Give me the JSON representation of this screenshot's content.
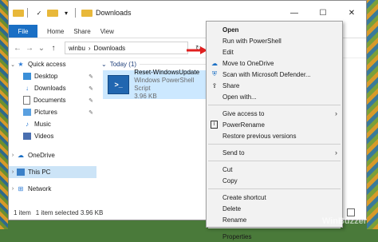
{
  "window": {
    "title": "Downloads"
  },
  "ribbon": {
    "file": "File",
    "tabs": [
      "Home",
      "Share",
      "View"
    ]
  },
  "address": {
    "prefix": "winbu",
    "path": "Downloads"
  },
  "sidebar": {
    "quick_access": "Quick access",
    "items": [
      {
        "label": "Desktop"
      },
      {
        "label": "Downloads"
      },
      {
        "label": "Documents"
      },
      {
        "label": "Pictures"
      },
      {
        "label": "Music"
      },
      {
        "label": "Videos"
      }
    ],
    "onedrive": "OneDrive",
    "this_pc": "This PC",
    "network": "Network"
  },
  "content": {
    "group": "Today (1)",
    "file": {
      "name": "Reset-WindowsUpdate",
      "type": "Windows PowerShell Script",
      "size": "3.96 KB"
    }
  },
  "status": {
    "count": "1 item",
    "selection": "1 item selected  3.96 KB"
  },
  "context_menu": {
    "open": "Open",
    "run_ps": "Run with PowerShell",
    "edit": "Edit",
    "move_onedrive": "Move to OneDrive",
    "scan": "Scan with Microsoft Defender...",
    "share": "Share",
    "open_with": "Open with...",
    "give_access": "Give access to",
    "powerrename": "PowerRename",
    "restore": "Restore previous versions",
    "send_to": "Send to",
    "cut": "Cut",
    "copy": "Copy",
    "create_shortcut": "Create shortcut",
    "delete": "Delete",
    "rename": "Rename",
    "properties": "Properties"
  },
  "watermark": "WinBuzzer",
  "colors": {
    "accent": "#1a6fc4",
    "arrow": "#e02020",
    "selection": "#cce8ff"
  }
}
